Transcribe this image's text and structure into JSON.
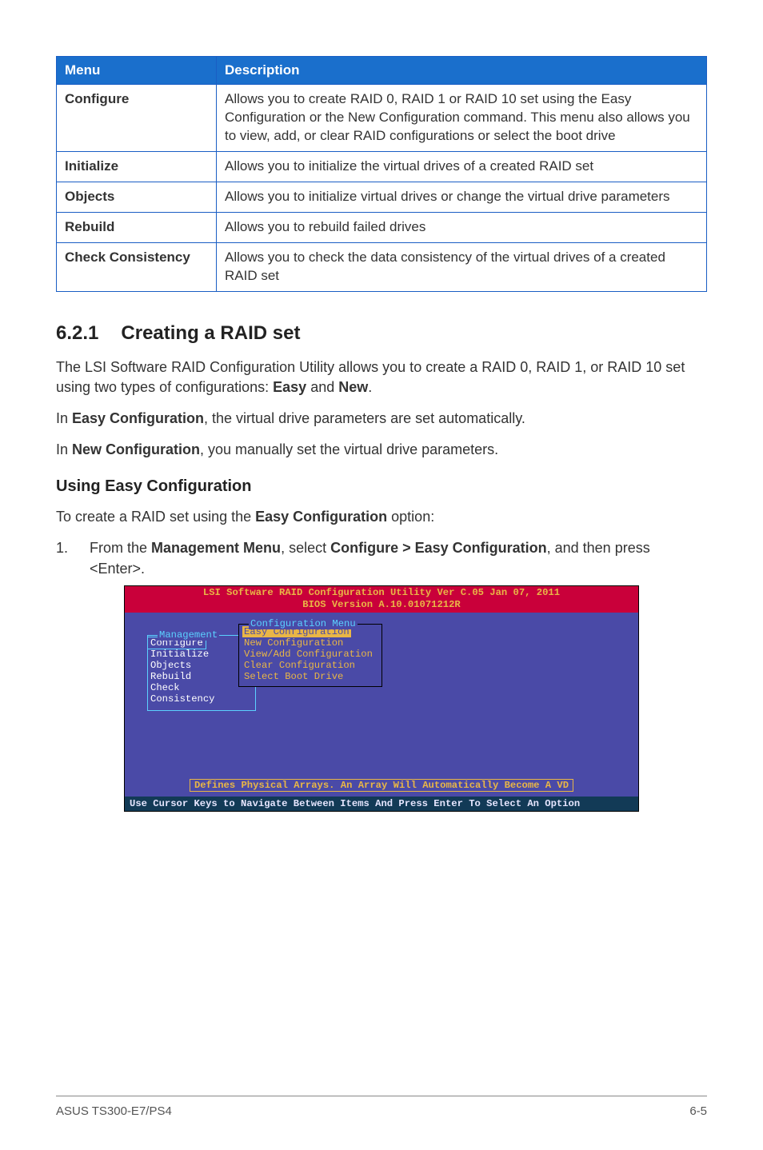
{
  "table": {
    "headers": [
      "Menu",
      "Description"
    ],
    "rows": [
      {
        "menu": "Configure",
        "desc": "Allows you to create RAID 0, RAID 1 or RAID 10 set using the Easy Configuration or the New Configuration command. This menu also allows you to view, add, or clear RAID configurations or select the boot drive"
      },
      {
        "menu": "Initialize",
        "desc": "Allows you to initialize the virtual drives of a created RAID set"
      },
      {
        "menu": "Objects",
        "desc": "Allows you to initialize virtual drives or change the virtual drive parameters"
      },
      {
        "menu": "Rebuild",
        "desc": "Allows you to rebuild failed drives"
      },
      {
        "menu": "Check Consistency",
        "desc": "Allows you to check the data consistency of the virtual drives of a created RAID set"
      }
    ]
  },
  "section": {
    "number": "6.2.1",
    "title": "Creating a RAID set",
    "p1a": "The LSI Software RAID Configuration Utility allows you to create a RAID 0, RAID 1, or RAID 10 set using two types of configurations: ",
    "p1b_easy": "Easy",
    "p1b_and": " and ",
    "p1b_new": "New",
    "p1b_end": ".",
    "p2a": "In ",
    "p2b": "Easy Configuration",
    "p2c": ", the virtual drive parameters are set automatically.",
    "p3a": "In ",
    "p3b": "New Configuration",
    "p3c": ", you manually set the virtual drive parameters."
  },
  "subheading": "Using Easy Configuration",
  "subpara_a": "To create a RAID set using the ",
  "subpara_b": "Easy Configuration",
  "subpara_c": " option:",
  "step1": {
    "num": "1.",
    "a": "From the ",
    "b": "Management Menu",
    "c": ", select ",
    "d": "Configure > Easy Configuration",
    "e": ", and then press <Enter>."
  },
  "bios": {
    "title_line1": "LSI Software RAID Configuration Utility Ver C.05 Jan 07, 2011",
    "title_line2": "BIOS Version  A.10.01071212R",
    "mgmt_legend": "Management",
    "mgmt_items": [
      "Configure",
      "Initialize",
      "Objects",
      "Rebuild",
      "Check Consistency"
    ],
    "cfg_legend": "Configuration Menu",
    "cfg_items": [
      "Easy Configuration",
      "New Configuration",
      "View/Add Configuration",
      "Clear Configuration",
      "Select Boot Drive"
    ],
    "bottom_msg": "Defines Physical Arrays. An Array Will Automatically Become A VD",
    "footer": "Use Cursor Keys to Navigate Between Items And Press Enter To Select An Option"
  },
  "page_footer": {
    "left": "ASUS TS300-E7/PS4",
    "right": "6-5"
  }
}
